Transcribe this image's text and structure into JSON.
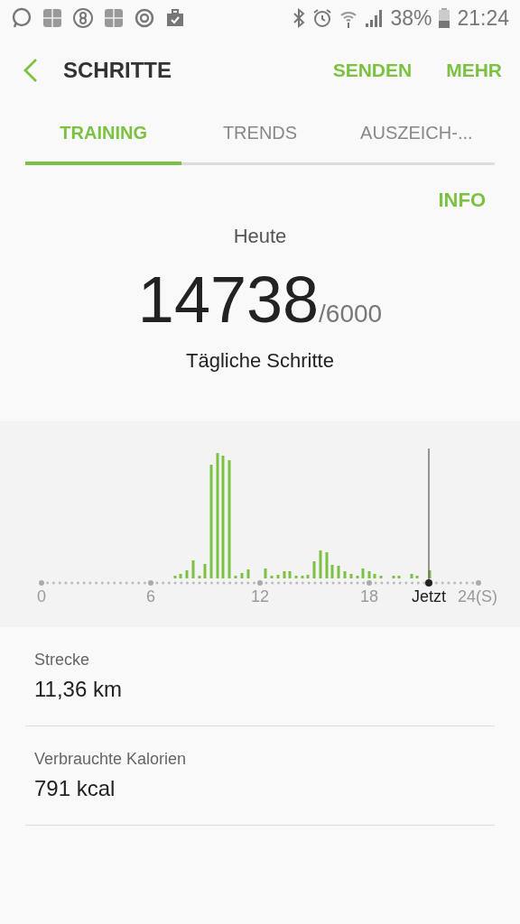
{
  "status_bar": {
    "battery": "38%",
    "time": "21:24"
  },
  "app_bar": {
    "title": "SCHRITTE",
    "actions": [
      "SENDEN",
      "MEHR"
    ]
  },
  "tabs": [
    {
      "label": "TRAINING",
      "selected": true
    },
    {
      "label": "TRENDS",
      "selected": false
    },
    {
      "label": "AUSZEICH-...",
      "selected": false
    }
  ],
  "info_link": "INFO",
  "summary": {
    "period": "Heute",
    "steps": "14738",
    "goal": "/6000",
    "caption": "Tägliche Schritte"
  },
  "chart": {
    "x_labels": [
      "0",
      "6",
      "12",
      "18"
    ],
    "now_label": "Jetzt",
    "end_label": "24(S)"
  },
  "stats": [
    {
      "label": "Strecke",
      "value": "11,36 km"
    },
    {
      "label": "Verbrauchte Kalorien",
      "value": "791 kcal"
    }
  ]
}
